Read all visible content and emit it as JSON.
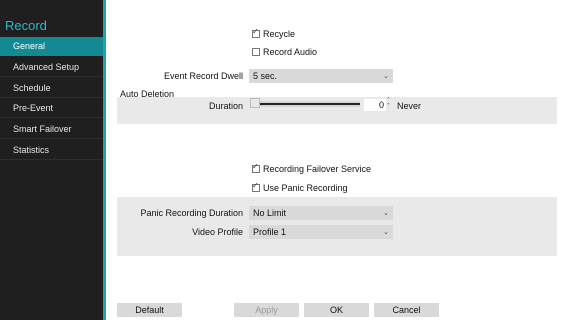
{
  "sidebar": {
    "title": "Record",
    "items": [
      {
        "label": "General",
        "active": true
      },
      {
        "label": "Advanced Setup",
        "active": false
      },
      {
        "label": "Schedule",
        "active": false
      },
      {
        "label": "Pre-Event",
        "active": false
      },
      {
        "label": "Smart Failover",
        "active": false
      },
      {
        "label": "Statistics",
        "active": false
      }
    ]
  },
  "general": {
    "recycle": {
      "label": "Recycle",
      "checked": true
    },
    "record_audio": {
      "label": "Record Audio",
      "checked": false
    },
    "event_record_dwell": {
      "label": "Event Record Dwell",
      "value": "5 sec."
    },
    "auto_deletion": {
      "section_label": "Auto Deletion",
      "duration_label": "Duration",
      "duration_value": "0",
      "duration_unit": "Never",
      "slider_fraction": 0.0
    },
    "recording_failover_service": {
      "label": "Recording Failover Service",
      "checked": true
    },
    "use_panic_recording": {
      "label": "Use Panic Recording",
      "checked": true
    },
    "panic_recording_duration": {
      "label": "Panic Recording Duration",
      "value": "No Limit"
    },
    "video_profile": {
      "label": "Video Profile",
      "value": "Profile 1"
    }
  },
  "buttons": {
    "default": "Default",
    "apply": "Apply",
    "ok": "OK",
    "cancel": "Cancel"
  },
  "colors": {
    "sidebar_bg": "#1f1f1f",
    "accent": "#1aa6b0",
    "active_item": "#138a93",
    "panel_bg": "#e9e9e9"
  }
}
